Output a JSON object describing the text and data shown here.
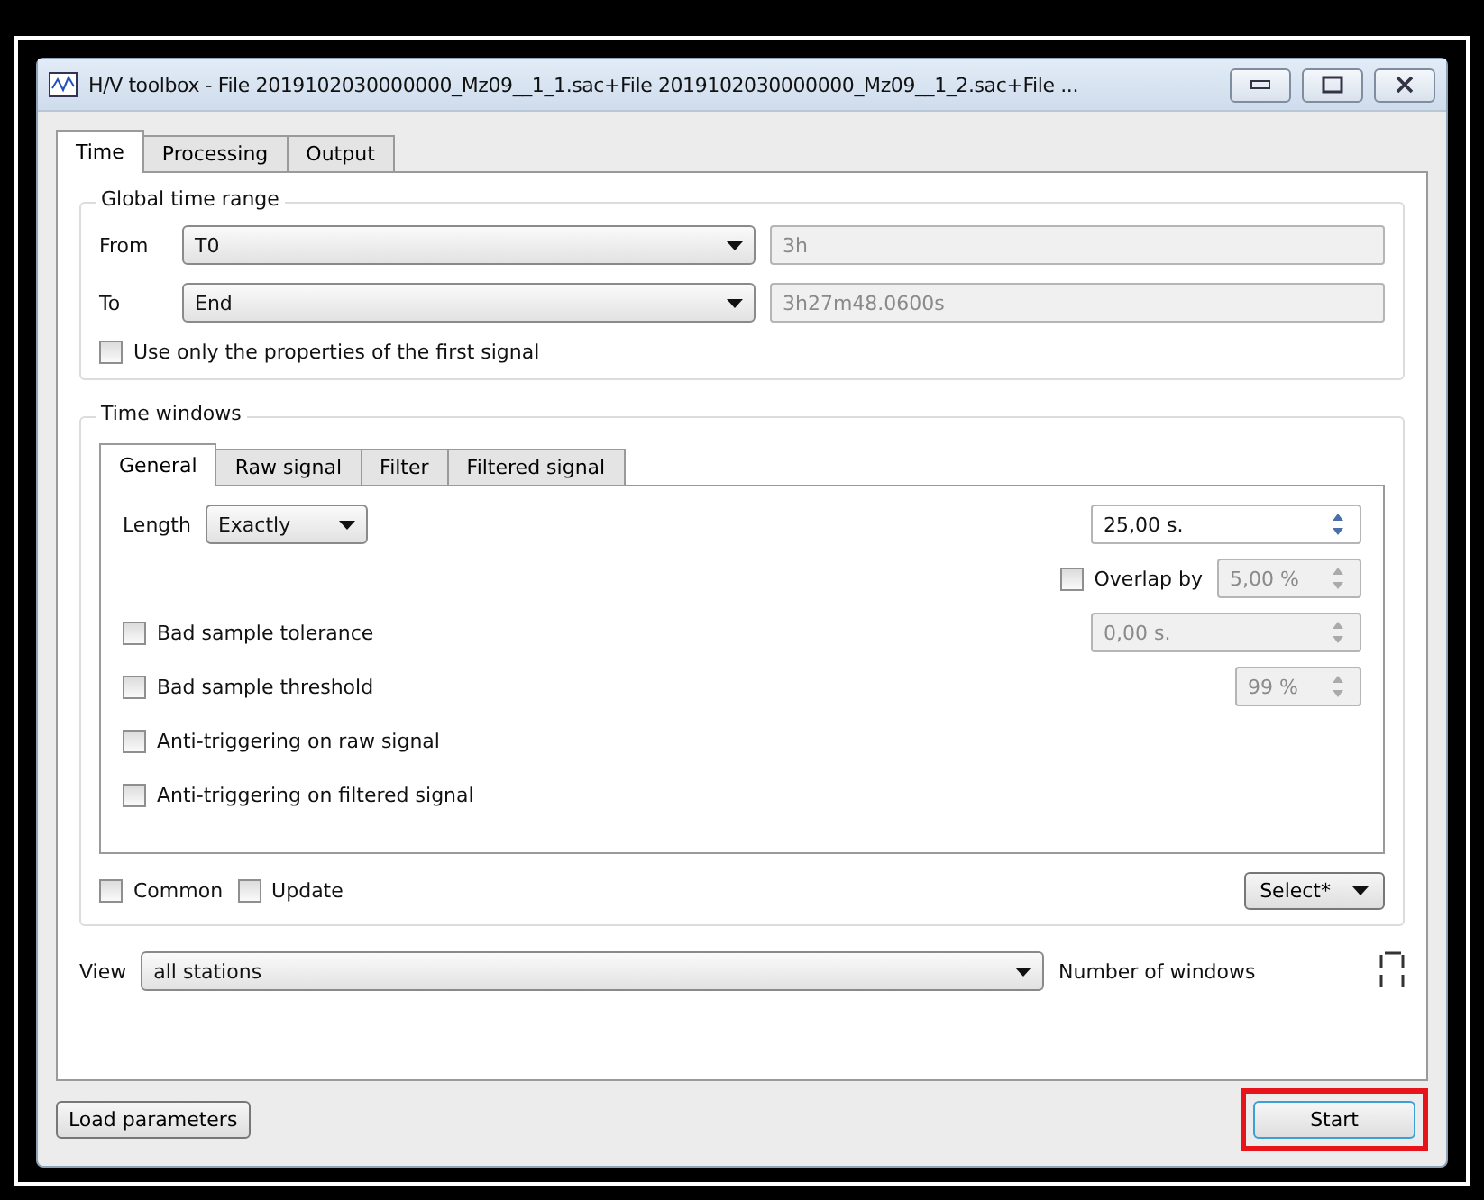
{
  "window": {
    "title": "H/V toolbox - File 2019102030000000_Mz09__1_1.sac+File 2019102030000000_Mz09__1_2.sac+File ..."
  },
  "tabs": [
    {
      "label": "Time",
      "selected": true
    },
    {
      "label": "Processing",
      "selected": false
    },
    {
      "label": "Output",
      "selected": false
    }
  ],
  "global_time_range": {
    "title": "Global time range",
    "rows": [
      {
        "label": "From",
        "value": "T0",
        "reading": "3h"
      },
      {
        "label": "To",
        "value": "End",
        "reading": "3h27m48.0600s"
      }
    ],
    "first_signal_only": {
      "label": "Use only the properties of the first signal",
      "checked": false
    }
  },
  "time_windows": {
    "title": "Time windows",
    "tabs": [
      {
        "label": "General",
        "selected": true
      },
      {
        "label": "Raw signal",
        "selected": false
      },
      {
        "label": "Filter",
        "selected": false
      },
      {
        "label": "Filtered signal",
        "selected": false
      }
    ],
    "length": {
      "label": "Length",
      "value": "Exactly",
      "amount": "25,00 s."
    },
    "overlap": {
      "label": "Overlap by",
      "checked": false,
      "value": "5,00 %",
      "disabled": true
    },
    "options": [
      {
        "label": "Bad sample tolerance",
        "checked": false,
        "field": {
          "value": "0,00 s.",
          "disabled": true,
          "wide": true
        }
      },
      {
        "label": "Bad sample threshold",
        "checked": false,
        "field": {
          "value": "99 %",
          "disabled": true,
          "wide": false
        }
      },
      {
        "label": "Anti-triggering on raw signal",
        "checked": false
      },
      {
        "label": "Anti-triggering on filtered signal",
        "checked": false
      }
    ],
    "footer": [
      {
        "label": "Common",
        "checked": false
      },
      {
        "label": "Update",
        "checked": false
      }
    ],
    "select_button": "Select*"
  },
  "view": {
    "label": "View",
    "value": "all stations",
    "count_label": "Number of windows"
  },
  "buttons": [
    {
      "label": "Load parameters",
      "highlighted": false
    },
    {
      "label": "Start",
      "highlighted": true
    }
  ]
}
